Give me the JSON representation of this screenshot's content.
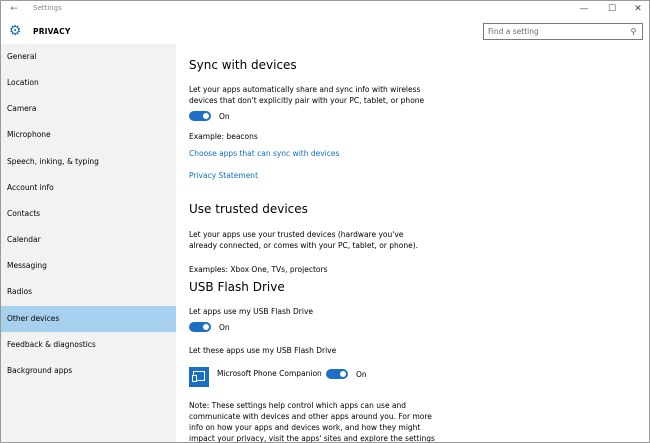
{
  "window": {
    "title": "Settings",
    "controls": {
      "minimize": "—",
      "maximize": "☐",
      "close": "✕"
    }
  },
  "header": {
    "section": "PRIVACY",
    "search_placeholder": "Find a setting"
  },
  "sidebar": {
    "items": [
      {
        "label": "General"
      },
      {
        "label": "Location"
      },
      {
        "label": "Camera"
      },
      {
        "label": "Microphone"
      },
      {
        "label": "Speech, inking, & typing"
      },
      {
        "label": "Account info"
      },
      {
        "label": "Contacts"
      },
      {
        "label": "Calendar"
      },
      {
        "label": "Messaging"
      },
      {
        "label": "Radios"
      },
      {
        "label": "Other devices",
        "selected": true
      },
      {
        "label": "Feedback & diagnostics"
      },
      {
        "label": "Background apps"
      }
    ]
  },
  "content": {
    "sync": {
      "heading": "Sync with devices",
      "description": "Let your apps automatically share and sync info with wireless devices that don't explicitly pair with your PC, tablet, or phone",
      "toggle_state": "On",
      "example": "Example: beacons",
      "link_choose": "Choose apps that can sync with devices",
      "link_privacy": "Privacy Statement"
    },
    "trusted": {
      "heading": "Use trusted devices",
      "description": "Let your apps use your trusted devices (hardware you've already connected, or comes with your PC, tablet, or phone).",
      "examples": "Examples: Xbox One, TVs, projectors"
    },
    "usb": {
      "heading": "USB Flash Drive",
      "allow_label": "Let apps use my USB Flash Drive",
      "toggle_state": "On",
      "apps_label": "Let these apps use my USB Flash Drive",
      "app_name": "Microsoft Phone Companion",
      "app_toggle_state": "On"
    },
    "note": "Note: These settings help control which apps can use and communicate with devices and other apps around you. For more info on how your apps and devices work, and how they might impact your privacy, visit the apps' sites and explore the settings for"
  },
  "colors": {
    "accent": "#1e6fc2",
    "selected_nav": "#a6d0ee",
    "sidebar_bg": "#f2f2f2",
    "link": "#0f6fc6"
  }
}
